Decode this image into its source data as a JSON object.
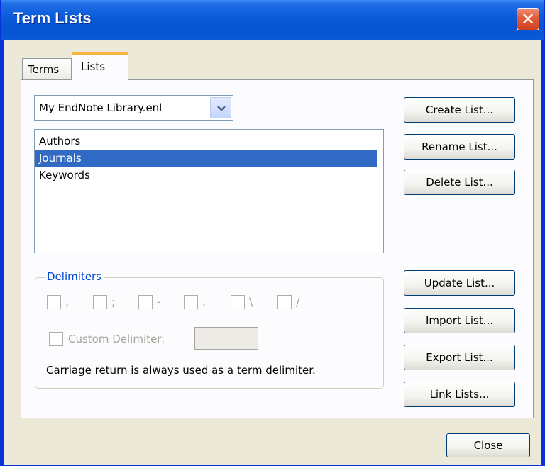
{
  "window": {
    "title": "Term Lists",
    "close_glyph": "✕"
  },
  "tabs": [
    {
      "label": "Terms"
    },
    {
      "label": "Lists"
    }
  ],
  "library_select": {
    "value": "My EndNote Library.enl"
  },
  "lists": {
    "items": [
      "Authors",
      "Journals",
      "Keywords"
    ],
    "selected": "Journals"
  },
  "buttons": {
    "create": "Create List...",
    "rename": "Rename List...",
    "delete": "Delete List...",
    "update": "Update List...",
    "import": "Import List...",
    "export": "Export List...",
    "link": "Link Lists...",
    "close": "Close"
  },
  "delimiters": {
    "label": "Delimiters",
    "options": [
      ",",
      ";",
      "-",
      ".",
      "\\",
      "/"
    ],
    "custom_label": "Custom Delimiter:",
    "custom_value": "",
    "note": "Carriage return is always used as a term delimiter."
  },
  "colors": {
    "title_bar": "#0a5ad9",
    "selection": "#316ac5",
    "group_label": "#0046d5"
  }
}
